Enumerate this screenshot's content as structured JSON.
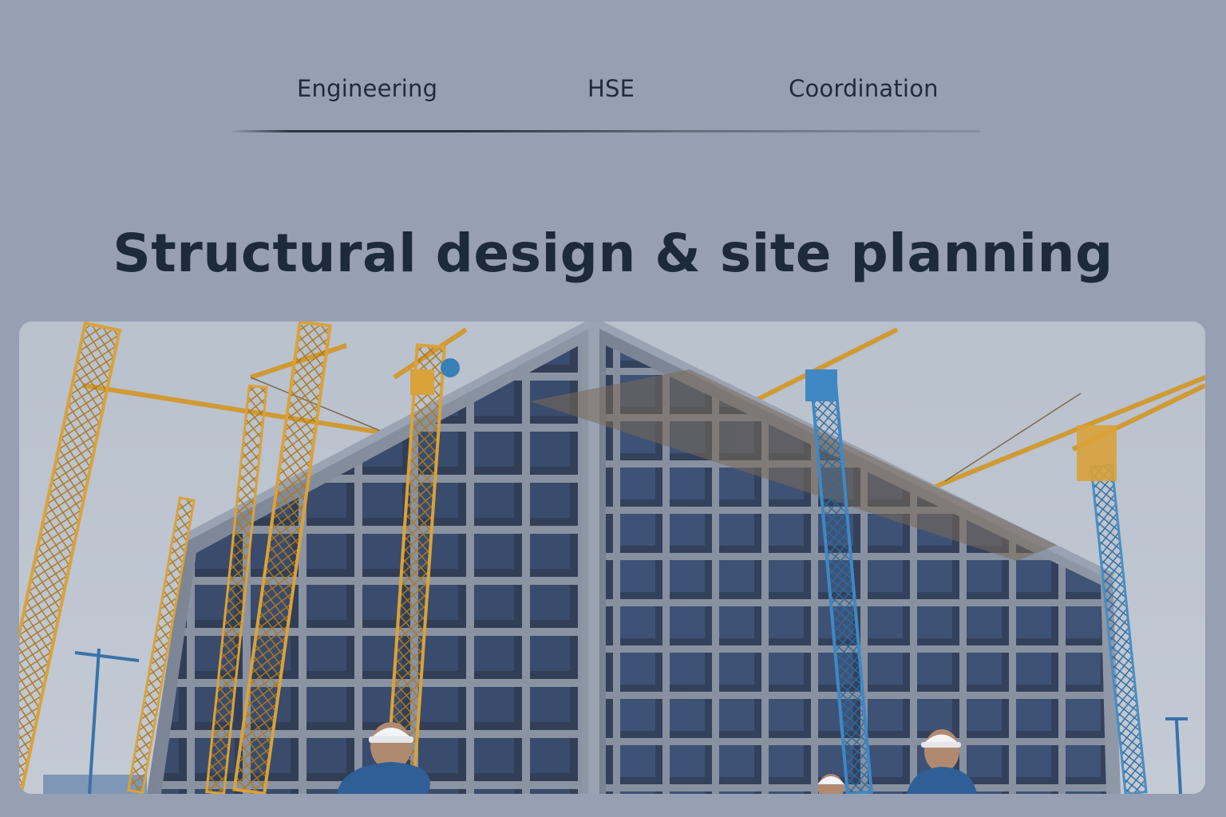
{
  "tabs": [
    {
      "label": "Engineering"
    },
    {
      "label": "HSE"
    },
    {
      "label": "Coordination"
    }
  ],
  "hero": {
    "title": "Structural design & site planning"
  },
  "colors": {
    "page_background": "#97a0b2",
    "text": "#1d2a3c",
    "crane_yellow": "#d9a23a",
    "crane_blue": "#3f88c4",
    "concrete": "#7e8796"
  }
}
